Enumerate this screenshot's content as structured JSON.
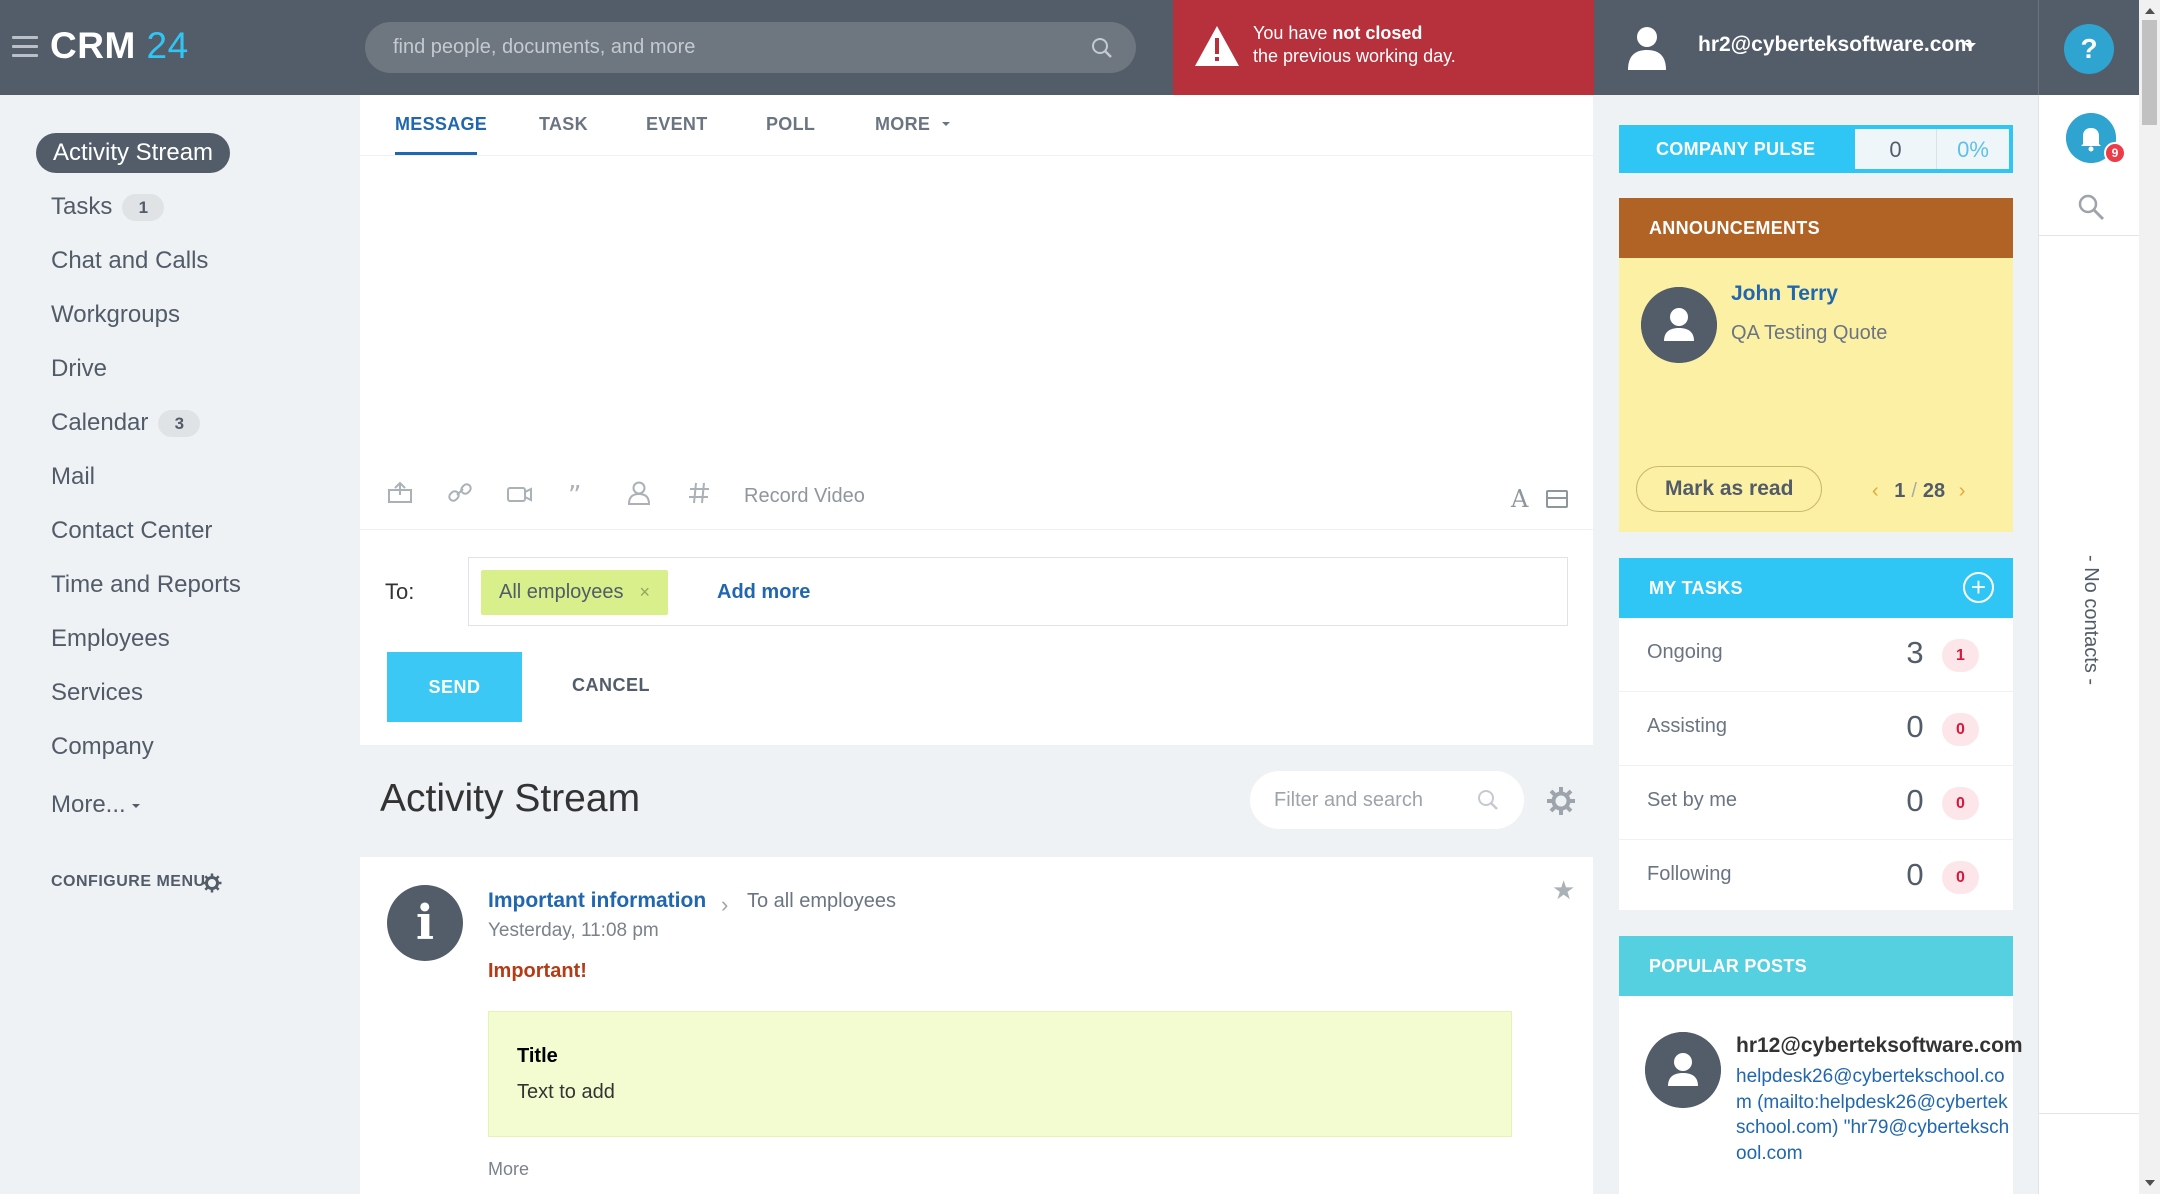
{
  "header": {
    "logo_text": "CRM",
    "logo_number": "24",
    "search_placeholder": "find people, documents, and more",
    "warning_prefix": "You have ",
    "warning_bold": "not closed",
    "warning_line2": "the previous working day.",
    "user_email": "hr2@cyberteksoftware.com",
    "help_label": "?"
  },
  "sidebar": {
    "items": [
      {
        "label": "Activity Stream"
      },
      {
        "label": "Tasks",
        "count": "1"
      },
      {
        "label": "Chat and Calls"
      },
      {
        "label": "Workgroups"
      },
      {
        "label": "Drive"
      },
      {
        "label": "Calendar",
        "count": "3"
      },
      {
        "label": "Mail"
      },
      {
        "label": "Contact Center"
      },
      {
        "label": "Time and Reports"
      },
      {
        "label": "Employees"
      },
      {
        "label": "Services"
      },
      {
        "label": "Company"
      },
      {
        "label": "More..."
      }
    ],
    "configure_label": "CONFIGURE MENU"
  },
  "composer": {
    "tabs": [
      {
        "label": "MESSAGE"
      },
      {
        "label": "TASK"
      },
      {
        "label": "EVENT"
      },
      {
        "label": "POLL"
      },
      {
        "label": "MORE"
      }
    ],
    "toolbar_icons": [
      "upload-icon",
      "link-icon",
      "video-icon",
      "quote-icon",
      "mention-icon",
      "hashtag-icon"
    ],
    "record_video_label": "Record Video",
    "font_label": "A",
    "to_label": "To:",
    "recipient": "All employees",
    "recipient_remove": "×",
    "add_more_label": "Add more",
    "send_label": "SEND",
    "cancel_label": "CANCEL"
  },
  "stream": {
    "title": "Activity Stream",
    "filter_placeholder": "Filter and search"
  },
  "post": {
    "author": "Important information",
    "chevron": "›",
    "destination": "To all employees",
    "time": "Yesterday, 11:08 pm",
    "star": "★",
    "important_label": "Important!",
    "box_title": "Title",
    "box_text": "Text to add",
    "more_label": "More",
    "avatar_glyph": "i"
  },
  "pulse": {
    "label": "COMPANY PULSE",
    "count": "0",
    "percent": "0%"
  },
  "announcements": {
    "title": "ANNOUNCEMENTS",
    "author": "John Terry",
    "text": "QA Testing Quote",
    "mark_read_label": "Mark as read",
    "pager_prev": "‹",
    "pager_current": "1",
    "pager_sep": "/",
    "pager_total": "28",
    "pager_next": "›"
  },
  "my_tasks": {
    "title": "MY TASKS",
    "add_label": "+",
    "rows": [
      {
        "label": "Ongoing",
        "count": "3",
        "badge": "1"
      },
      {
        "label": "Assisting",
        "count": "0",
        "badge": "0"
      },
      {
        "label": "Set by me",
        "count": "0",
        "badge": "0"
      },
      {
        "label": "Following",
        "count": "0",
        "badge": "0"
      }
    ]
  },
  "popular_posts": {
    "title": "POPULAR POSTS",
    "author": "hr12@cyberteksoftware.com",
    "text": "helpdesk26@cybertekschool.com (mailto:helpdesk26@cybertekschool.com) \"hr79@cybertekschool.com"
  },
  "rightbar": {
    "notification_count": "9",
    "no_contacts_label": "- No contacts -"
  },
  "colors": {
    "header_bg": "#535c69",
    "accent_blue": "#2fc6f6",
    "link_blue": "#2067b0",
    "warning_red": "#b7313c",
    "announce_brown": "#b06325",
    "announce_yellow": "#fcf0a5"
  }
}
